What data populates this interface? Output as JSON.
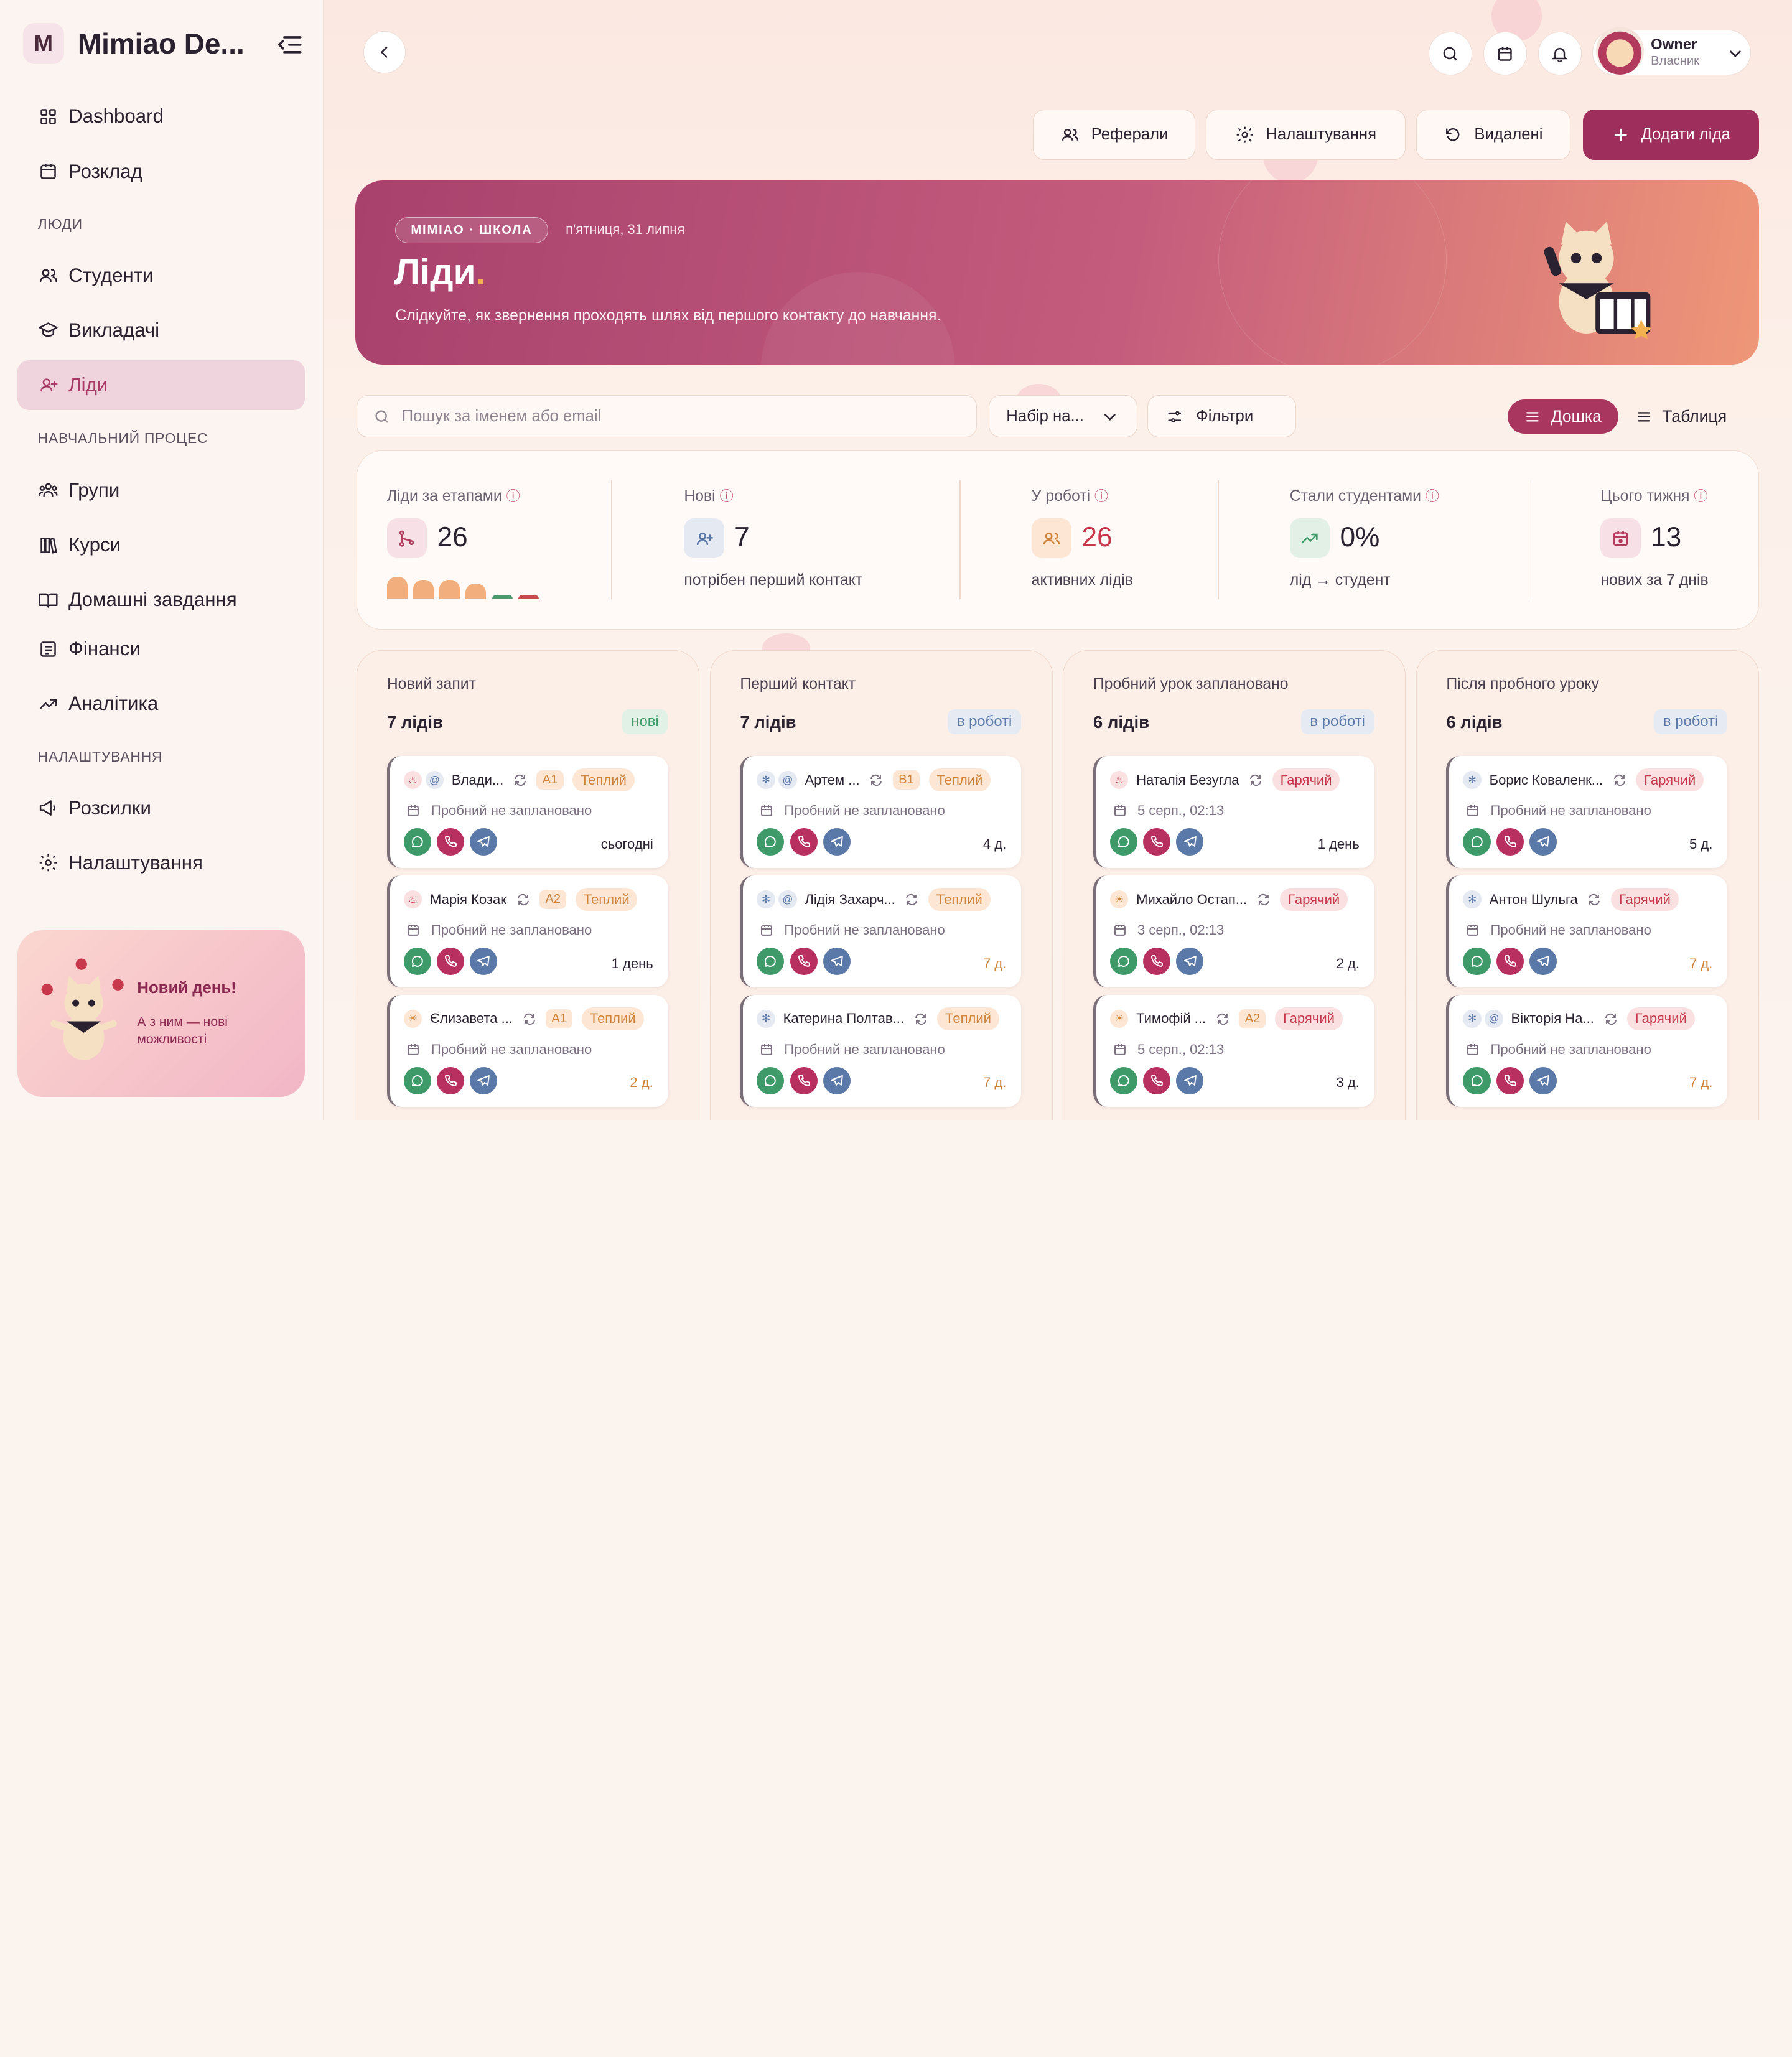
{
  "sidebar": {
    "logo_letter": "M",
    "app_name": "Mimiao De...",
    "nav": [
      {
        "label": "Dashboard",
        "icon": "grid-icon"
      },
      {
        "label": "Розклад",
        "icon": "calendar-icon"
      }
    ],
    "sections": {
      "people": "ЛЮДИ",
      "learning": "НАВЧАЛЬНИЙ ПРОЦЕС",
      "settings": "НАЛАШТУВАННЯ"
    },
    "people_items": [
      {
        "label": "Студенти",
        "icon": "users-icon"
      },
      {
        "label": "Викладачі",
        "icon": "graduation-cap-icon"
      },
      {
        "label": "Ліди",
        "icon": "user-plus-icon",
        "active": true
      }
    ],
    "learning_items": [
      {
        "label": "Групи",
        "icon": "group-icon"
      },
      {
        "label": "Курси",
        "icon": "library-icon"
      },
      {
        "label": "Домашні завдання",
        "icon": "book-open-icon"
      },
      {
        "label": "Фінанси",
        "icon": "receipt-icon"
      },
      {
        "label": "Аналітика",
        "icon": "trend-icon"
      }
    ],
    "settings_items": [
      {
        "label": "Розсилки",
        "icon": "megaphone-icon"
      },
      {
        "label": "Налаштування",
        "icon": "gear-icon"
      }
    ],
    "promo": {
      "title": "Новий день!",
      "subtitle": "А з ним — нові можливості"
    }
  },
  "header": {
    "user_name": "Owner",
    "user_role": "Власник",
    "actions": {
      "referrals": "Реферали",
      "settings": "Налаштування",
      "deleted": "Видалені",
      "add_lead": "Додати ліда"
    }
  },
  "hero": {
    "pill": "MIMIAO · ШКОЛА",
    "date": "п'ятниця, 31 липня",
    "title": "Ліди",
    "subtitle": "Слідкуйте, як звернення проходять шлях від першого контакту до навчання."
  },
  "toolbar": {
    "search_placeholder": "Пошук за іменем або email",
    "set_select": "Набір на...",
    "filters": "Фільтри",
    "view_board": "Дошка",
    "view_table": "Таблиця"
  },
  "stats": {
    "stages": {
      "label": "Ліди за етапами",
      "value": "26",
      "bars": [
        {
          "value": 7,
          "color": "#f2ae7c"
        },
        {
          "value": 6,
          "color": "#f2ae7c"
        },
        {
          "value": 6,
          "color": "#f2ae7c"
        },
        {
          "value": 5,
          "color": "#f2ae7c"
        },
        {
          "value": 1,
          "color": "#4a9a70"
        },
        {
          "value": 1,
          "color": "#c94a4a"
        }
      ]
    },
    "new": {
      "label": "Нові",
      "value": "7",
      "sub": "потрібен перший контакт"
    },
    "in_work": {
      "label": "У роботі",
      "value": "26",
      "sub": "активних лідів"
    },
    "converted": {
      "label": "Стали студентами",
      "value": "0%",
      "sub": "лід → студент"
    },
    "week": {
      "label": "Цього тижня",
      "value": "13",
      "sub": "нових за 7 днів"
    }
  },
  "columns": [
    {
      "name": "Новий запит",
      "count": "7 лідів",
      "badge": "нові",
      "badge_type": "new",
      "cards": [
        {
          "name": "Влади...",
          "status_icon": "flame",
          "email": true,
          "level": "A1",
          "tag": "Теплий",
          "tag_type": "warm",
          "trial": "Пробний не заплановано",
          "age": "сьогодні",
          "warn": false
        },
        {
          "name": "Марія Козак",
          "status_icon": "flame",
          "email": false,
          "level": "A2",
          "tag": "Теплий",
          "tag_type": "warm",
          "trial": "Пробний не заплановано",
          "age": "1 день",
          "warn": false
        },
        {
          "name": "Єлизавета ...",
          "status_icon": "sun",
          "email": false,
          "level": "A1",
          "tag": "Теплий",
          "tag_type": "warm",
          "trial": "Пробний не заплановано",
          "age": "2 д.",
          "warn": true
        }
      ]
    },
    {
      "name": "Перший контакт",
      "count": "7 лідів",
      "badge": "в роботі",
      "badge_type": "work",
      "cards": [
        {
          "name": "Артем ...",
          "status_icon": "snow",
          "email": true,
          "level": "B1",
          "tag": "Теплий",
          "tag_type": "warm",
          "trial": "Пробний не заплановано",
          "age": "4 д.",
          "warn": false
        },
        {
          "name": "Лідія Захарч...",
          "status_icon": "snow",
          "email": true,
          "level": "",
          "tag": "Теплий",
          "tag_type": "warm",
          "trial": "Пробний не заплановано",
          "age": "7 д.",
          "warn": true
        },
        {
          "name": "Катерина Полтав...",
          "status_icon": "snow",
          "email": false,
          "level": "",
          "tag": "Теплий",
          "tag_type": "warm",
          "trial": "Пробний не заплановано",
          "age": "7 д.",
          "warn": true
        }
      ]
    },
    {
      "name": "Пробний урок заплановано",
      "count": "6 лідів",
      "badge": "в роботі",
      "badge_type": "work",
      "cards": [
        {
          "name": "Наталія Безугла",
          "status_icon": "flame",
          "email": false,
          "level": "",
          "tag": "Гарячий",
          "tag_type": "hot",
          "trial": "5 серп., 02:13",
          "age": "1 день",
          "warn": false
        },
        {
          "name": "Михайло Остап...",
          "status_icon": "sun",
          "email": false,
          "level": "",
          "tag": "Гарячий",
          "tag_type": "hot",
          "trial": "3 серп., 02:13",
          "age": "2 д.",
          "warn": false
        },
        {
          "name": "Тимофій ...",
          "status_icon": "sun",
          "email": false,
          "level": "A2",
          "tag": "Гарячий",
          "tag_type": "hot",
          "trial": "5 серп., 02:13",
          "age": "3 д.",
          "warn": false
        }
      ]
    },
    {
      "name": "Після пробного уроку",
      "count": "6 лідів",
      "badge": "в роботі",
      "badge_type": "work",
      "cards": [
        {
          "name": "Борис Коваленк...",
          "status_icon": "snow",
          "email": false,
          "level": "",
          "tag": "Гарячий",
          "tag_type": "hot",
          "trial": "Пробний не заплановано",
          "age": "5 д.",
          "warn": false
        },
        {
          "name": "Антон Шульга",
          "status_icon": "snow",
          "email": false,
          "level": "",
          "tag": "Гарячий",
          "tag_type": "hot",
          "trial": "Пробний не заплановано",
          "age": "7 д.",
          "warn": true
        },
        {
          "name": "Вікторія На...",
          "status_icon": "snow",
          "email": true,
          "level": "",
          "tag": "Гарячий",
          "tag_type": "hot",
          "trial": "Пробний не заплановано",
          "age": "7 д.",
          "warn": true
        }
      ]
    }
  ]
}
